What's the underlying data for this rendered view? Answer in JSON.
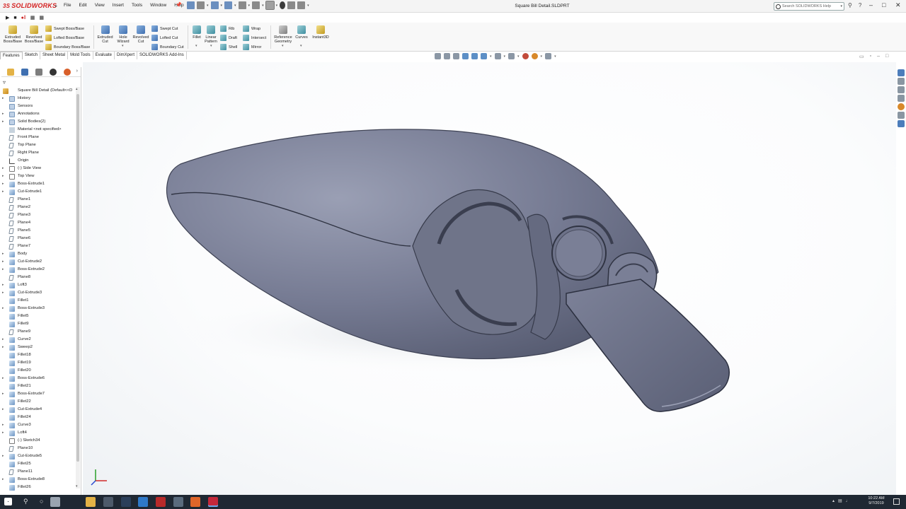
{
  "app": {
    "logo_text": "SOLIDWORKS",
    "logo_prefix": "3S",
    "document_title": "Square Bill Detail.SLDPRT",
    "menu": [
      "File",
      "Edit",
      "View",
      "Insert",
      "Tools",
      "Window",
      "Help"
    ],
    "search_placeholder": "Search SOLIDWORKS Help",
    "brand_color": "#d42020"
  },
  "ribbon": {
    "features": [
      {
        "label": "Extruded Boss/Base",
        "l1": "Extruded",
        "l2": "Boss/Base",
        "icon": "extrude-boss-icon"
      },
      {
        "label": "Revolved Boss/Base",
        "l1": "Revolved",
        "l2": "Boss/Base",
        "icon": "revolve-boss-icon"
      },
      {
        "label": "Swept Boss/Base",
        "icon": "swept-boss-icon"
      },
      {
        "label": "Lofted Boss/Base",
        "icon": "lofted-boss-icon"
      },
      {
        "label": "Boundary Boss/Base",
        "icon": "boundary-boss-icon"
      },
      {
        "label": "Extruded Cut",
        "l1": "Extruded",
        "l2": "Cut",
        "icon": "extrude-cut-icon"
      },
      {
        "label": "Hole Wizard",
        "l1": "Hole",
        "l2": "Wizard",
        "icon": "hole-wizard-icon"
      },
      {
        "label": "Revolved Cut",
        "l1": "Revolved",
        "l2": "Cut",
        "icon": "revolve-cut-icon"
      },
      {
        "label": "Swept Cut",
        "icon": "swept-cut-icon"
      },
      {
        "label": "Lofted Cut",
        "icon": "lofted-cut-icon"
      },
      {
        "label": "Boundary Cut",
        "icon": "boundary-cut-icon"
      },
      {
        "label": "Fillet",
        "icon": "fillet-icon"
      },
      {
        "label": "Linear Pattern",
        "l1": "Linear",
        "l2": "Pattern",
        "icon": "linear-pattern-icon"
      },
      {
        "label": "Rib",
        "icon": "rib-icon"
      },
      {
        "label": "Wrap",
        "icon": "wrap-icon"
      },
      {
        "label": "Draft",
        "icon": "draft-icon"
      },
      {
        "label": "Intersect",
        "icon": "intersect-icon"
      },
      {
        "label": "Shell",
        "icon": "shell-icon"
      },
      {
        "label": "Mirror",
        "icon": "mirror-icon"
      },
      {
        "label": "Reference Geometry",
        "l1": "Reference",
        "l2": "Geometry",
        "icon": "reference-geometry-icon"
      },
      {
        "label": "Curves",
        "icon": "curves-icon"
      },
      {
        "label": "Instant3D",
        "icon": "instant3d-icon"
      }
    ]
  },
  "tabs": [
    "Features",
    "Sketch",
    "Sheet Metal",
    "Mold Tools",
    "Evaluate",
    "DimXpert",
    "SOLIDWORKS Add-Ins"
  ],
  "active_tab": "Features",
  "tree": {
    "root": "Square Bill Detail  (Default<<D",
    "items": [
      {
        "label": "History",
        "icon": "history-icon",
        "exp": true
      },
      {
        "label": "Sensors",
        "icon": "sensor-icon",
        "exp": false
      },
      {
        "label": "Annotations",
        "icon": "annotations-icon",
        "exp": true
      },
      {
        "label": "Solid Bodies(2)",
        "icon": "solid-bodies-icon",
        "exp": true
      },
      {
        "label": "Material <not specified>",
        "icon": "material-icon",
        "exp": false
      },
      {
        "label": "Front Plane",
        "icon": "plane-icon",
        "exp": false
      },
      {
        "label": "Top Plane",
        "icon": "plane-icon",
        "exp": false
      },
      {
        "label": "Right Plane",
        "icon": "plane-icon",
        "exp": false
      },
      {
        "label": "Origin",
        "icon": "origin-icon",
        "exp": false
      },
      {
        "label": "(-) Side View",
        "icon": "sketch-icon",
        "exp": true
      },
      {
        "label": "Top View",
        "icon": "sketch-icon",
        "exp": true
      },
      {
        "label": "Boss-Extrude1",
        "icon": "extrude-icon",
        "exp": true
      },
      {
        "label": "Cut-Extrude1",
        "icon": "cut-extrude-icon",
        "exp": true
      },
      {
        "label": "Plane1",
        "icon": "plane-icon",
        "exp": false
      },
      {
        "label": "Plane2",
        "icon": "plane-icon",
        "exp": false
      },
      {
        "label": "Plane3",
        "icon": "plane-icon",
        "exp": false
      },
      {
        "label": "Plane4",
        "icon": "plane-icon",
        "exp": false
      },
      {
        "label": "Plane5",
        "icon": "plane-icon",
        "exp": false
      },
      {
        "label": "Plane6",
        "icon": "plane-icon",
        "exp": false
      },
      {
        "label": "Plane7",
        "icon": "plane-icon",
        "exp": false
      },
      {
        "label": "Body",
        "icon": "body-icon",
        "exp": true
      },
      {
        "label": "Cut-Extrude2",
        "icon": "cut-extrude-icon",
        "exp": true
      },
      {
        "label": "Boss-Extrude2",
        "icon": "extrude-icon",
        "exp": true
      },
      {
        "label": "Plane8",
        "icon": "plane-icon",
        "exp": false
      },
      {
        "label": "Loft3",
        "icon": "loft-icon",
        "exp": true
      },
      {
        "label": "Cut-Extrude3",
        "icon": "cut-extrude-icon",
        "exp": true
      },
      {
        "label": "Fillet1",
        "icon": "fillet-icon",
        "exp": false
      },
      {
        "label": "Boss-Extrude3",
        "icon": "extrude-icon",
        "exp": true
      },
      {
        "label": "Fillet5",
        "icon": "fillet-icon",
        "exp": false
      },
      {
        "label": "Fillet9",
        "icon": "fillet-icon",
        "exp": false
      },
      {
        "label": "Plane9",
        "icon": "plane-icon",
        "exp": false
      },
      {
        "label": "Curve2",
        "icon": "curve-icon",
        "exp": true
      },
      {
        "label": "Sweep2",
        "icon": "sweep-icon",
        "exp": true
      },
      {
        "label": "Fillet18",
        "icon": "fillet-icon",
        "exp": false
      },
      {
        "label": "Fillet19",
        "icon": "fillet-icon",
        "exp": false
      },
      {
        "label": "Fillet20",
        "icon": "fillet-icon",
        "exp": false
      },
      {
        "label": "Boss-Extrude6",
        "icon": "extrude-icon",
        "exp": true
      },
      {
        "label": "Fillet21",
        "icon": "fillet-icon",
        "exp": false
      },
      {
        "label": "Boss-Extrude7",
        "icon": "extrude-icon",
        "exp": true
      },
      {
        "label": "Fillet22",
        "icon": "fillet-icon",
        "exp": false
      },
      {
        "label": "Cut-Extrude4",
        "icon": "cut-extrude-icon",
        "exp": true
      },
      {
        "label": "Fillet24",
        "icon": "fillet-icon",
        "exp": false
      },
      {
        "label": "Curve3",
        "icon": "curve-icon",
        "exp": true
      },
      {
        "label": "Loft4",
        "icon": "loft-icon",
        "exp": true
      },
      {
        "label": "(-) Sketch34",
        "icon": "sketch-icon",
        "exp": false
      },
      {
        "label": "Plane10",
        "icon": "plane-icon",
        "exp": false
      },
      {
        "label": "Cut-Extrude5",
        "icon": "cut-extrude-icon",
        "exp": true
      },
      {
        "label": "Fillet25",
        "icon": "fillet-icon",
        "exp": false
      },
      {
        "label": "Plane11",
        "icon": "plane-icon",
        "exp": false
      },
      {
        "label": "Boss-Extrude8",
        "icon": "extrude-icon",
        "exp": true
      },
      {
        "label": "Fillet26",
        "icon": "fillet-icon",
        "exp": false
      }
    ]
  },
  "taskbar": {
    "time": "10:22 AM",
    "date": "9/7/2019",
    "apps": [
      "task-view-icon",
      "file-explorer-icon",
      "calculator-icon",
      "steam-icon",
      "snip-icon",
      "game-icon",
      "settings-icon",
      "firefox-icon",
      "solidworks-icon"
    ]
  },
  "model": {
    "name": "square bill crankbait lure",
    "color": "#6d7289"
  }
}
